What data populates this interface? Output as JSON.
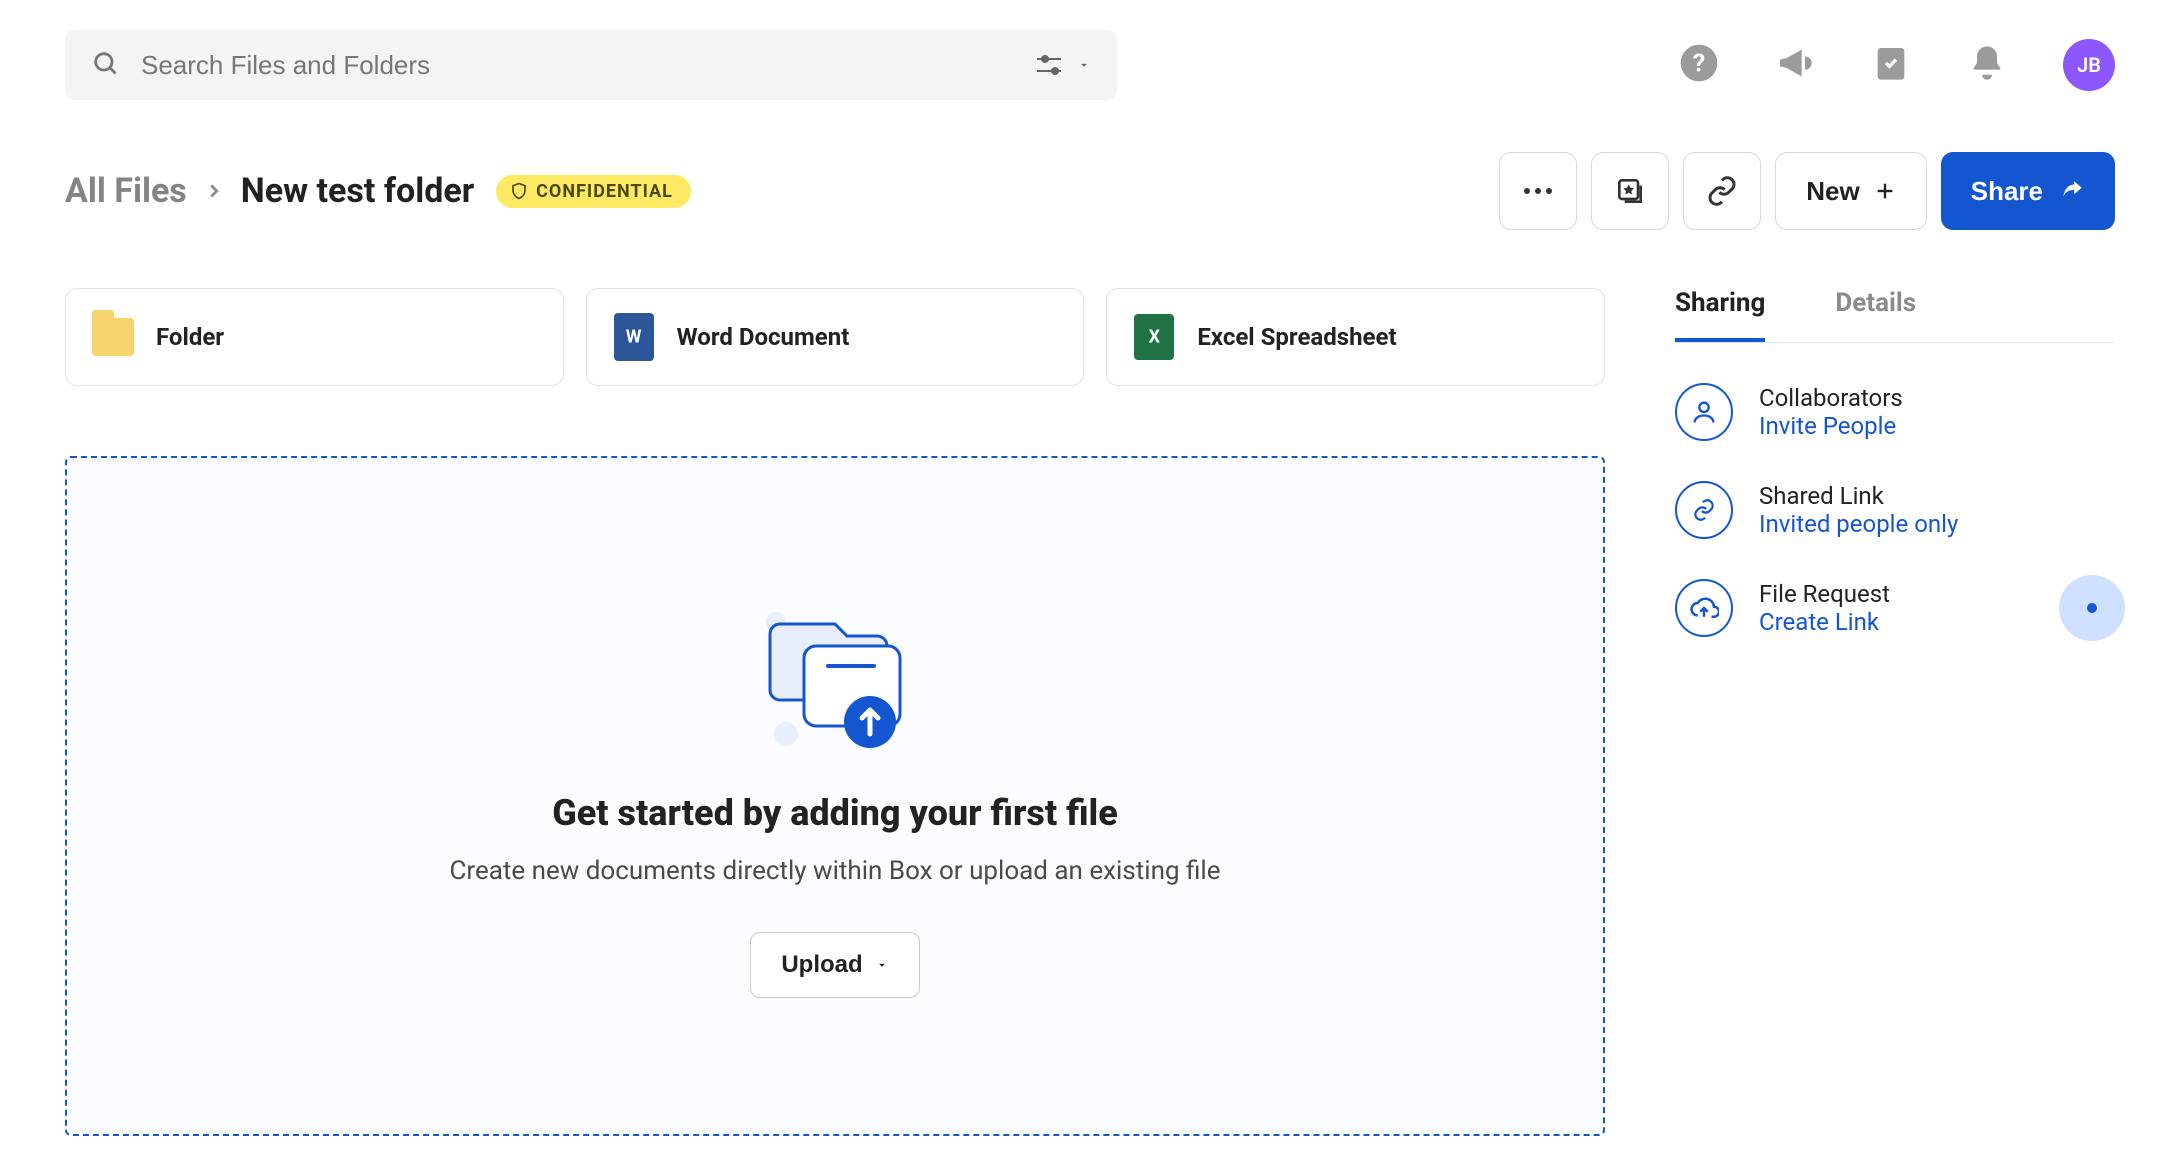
{
  "search": {
    "placeholder": "Search Files and Folders"
  },
  "avatar": {
    "initials": "JB"
  },
  "breadcrumb": {
    "root": "All Files",
    "current": "New test folder",
    "badge_label": "CONFIDENTIAL"
  },
  "actions": {
    "new_label": "New",
    "share_label": "Share"
  },
  "cards": [
    {
      "label": "Folder"
    },
    {
      "label": "Word Document"
    },
    {
      "label": "Excel Spreadsheet"
    }
  ],
  "dropzone": {
    "title": "Get started by adding your first file",
    "subtitle": "Create new documents directly within Box or upload an existing file",
    "upload_label": "Upload"
  },
  "panel": {
    "tabs": {
      "sharing": "Sharing",
      "details": "Details"
    },
    "items": [
      {
        "label": "Collaborators",
        "link": "Invite People"
      },
      {
        "label": "Shared Link",
        "link": "Invited people only"
      },
      {
        "label": "File Request",
        "link": "Create Link"
      }
    ]
  }
}
